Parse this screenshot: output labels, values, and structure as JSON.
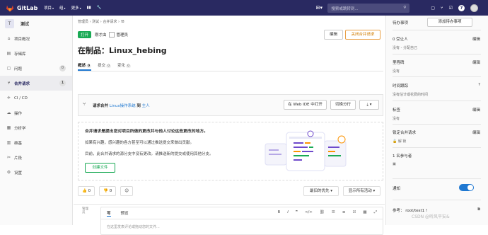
{
  "topbar": {
    "brand": "GitLab",
    "nav": [
      "项目",
      "组",
      "更多"
    ],
    "search_placeholder": "搜索或跳转到..."
  },
  "sidebar": {
    "project_avatar": "T",
    "project_name": "测试",
    "items": [
      {
        "label": "项目概况",
        "icon": "home-icon"
      },
      {
        "label": "存储库",
        "icon": "doc-icon"
      },
      {
        "label": "问题",
        "icon": "issues-icon",
        "count": "0"
      },
      {
        "label": "合并请求",
        "icon": "merge-request-icon",
        "count": "1",
        "active": true
      },
      {
        "label": "CI / CD",
        "icon": "rocket-icon"
      },
      {
        "label": "操作",
        "icon": "cloud-icon"
      },
      {
        "label": "分析学",
        "icon": "chart-icon"
      },
      {
        "label": "维基",
        "icon": "book-icon"
      },
      {
        "label": "片段",
        "icon": "snippet-icon"
      },
      {
        "label": "设置",
        "icon": "gear-icon"
      }
    ]
  },
  "breadcrumb": "管理员 › 测试 › 合并请求 › !8",
  "status": {
    "badge": "打开",
    "opened_text": "刚才由",
    "author": "管理员"
  },
  "buttons": {
    "edit": "编辑",
    "close": "关闭合并请求"
  },
  "title": "在制品：Linux_hebing",
  "tabs": [
    {
      "label": "概述",
      "count": "0"
    },
    {
      "label": "提交",
      "count": "0"
    },
    {
      "label": "变化",
      "count": "0"
    }
  ],
  "widget": {
    "request_label": "请求合并",
    "source": "Linux操作系统",
    "into": "到",
    "target": "主人",
    "open_ide": "在 Web IDE 中打开",
    "checkout": "切换分行",
    "download": "⤓ ▾"
  },
  "empty_state": {
    "heading": "合并请求是提出您对项目所做的更改并与他人讨论这些更改的地方。",
    "para1": "如果有兴趣，感兴趣的各方甚至可以通过推送提交来做出贡献。",
    "para2": "目前，此合并请求的源分支中没有更改。请推送新的提交或使用其他分支。",
    "create_file": "创建文件"
  },
  "reactions": {
    "thumbs_up": "0",
    "thumbs_down": "0"
  },
  "sorting": {
    "sort": "最旧的优先 ▾",
    "filter": "显示所有活动 ▾"
  },
  "comment": {
    "avatar_alt": "管理员",
    "write_tab": "写",
    "preview_tab": "预览",
    "placeholder": "在这里发表评论或拖动您的文件..."
  },
  "right": {
    "todo": "待办事项",
    "add_todo": "添加待办事项",
    "assignee_title": "0 受让人",
    "assignee_value": "没有 - 分配自己",
    "milestone_title": "里程碑",
    "milestone_value": "没有",
    "time_title": "时间跟踪",
    "time_value": "没有估计或花费的时间",
    "label_title": "标签",
    "label_value": "没有",
    "lock_title": "锁定合并请求",
    "lock_value": "🔓 解 锁",
    "participants": "1 名参与者",
    "notify": "通知",
    "reference_label": "参考：",
    "reference_value": "root/test1 !",
    "edit": "编辑"
  },
  "watermark": "CSDN @听风平安&"
}
